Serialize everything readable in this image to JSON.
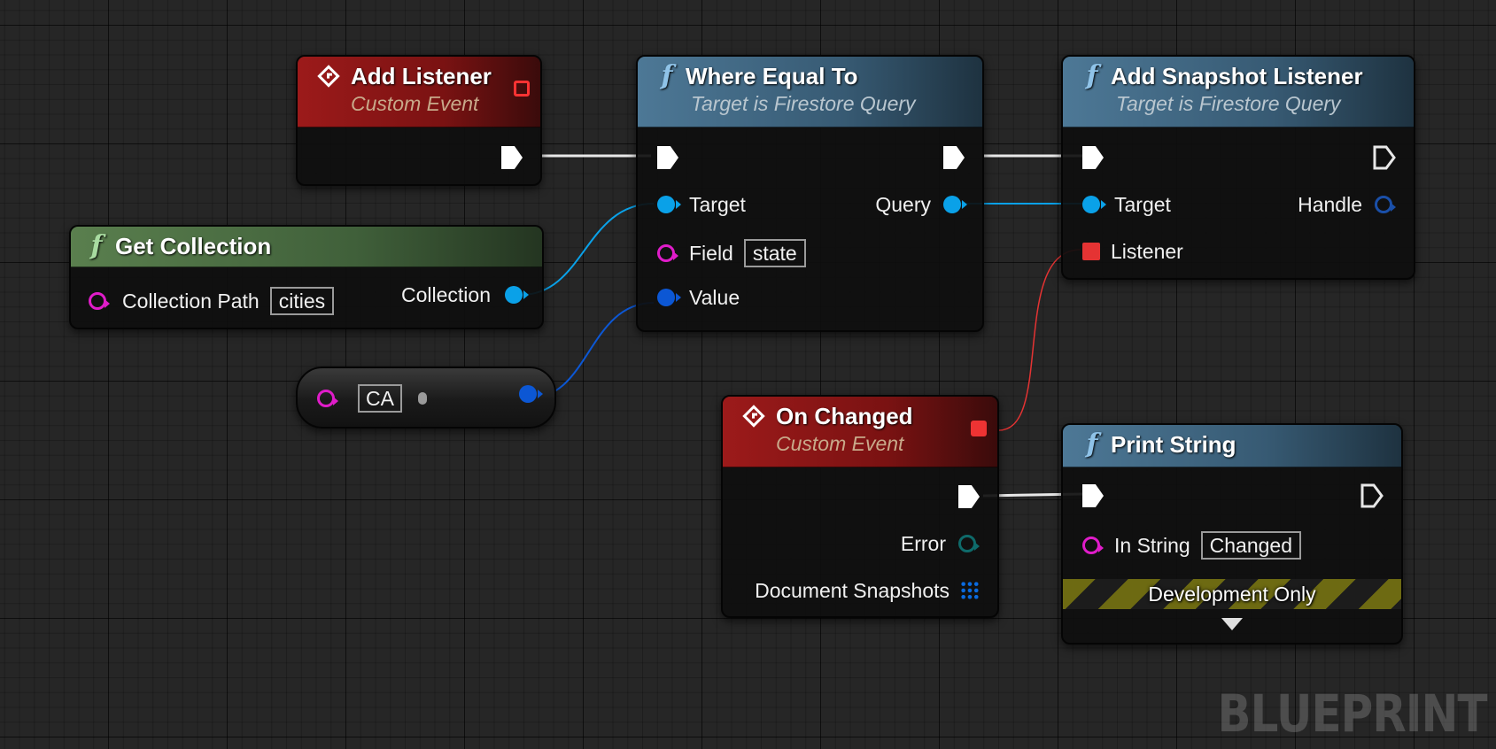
{
  "nodes": {
    "add_listener": {
      "title": "Add Listener",
      "subtitle": "Custom Event"
    },
    "get_collection": {
      "title": "Get Collection",
      "pin_collection_path": "Collection Path",
      "collection_path_value": "cities",
      "pin_collection": "Collection"
    },
    "literal": {
      "value": "CA"
    },
    "where_equal_to": {
      "title": "Where Equal To",
      "subtitle": "Target is Firestore Query",
      "pin_target": "Target",
      "pin_query": "Query",
      "pin_field": "Field",
      "field_value": "state",
      "pin_value": "Value"
    },
    "add_snapshot_listener": {
      "title": "Add Snapshot Listener",
      "subtitle": "Target is Firestore Query",
      "pin_target": "Target",
      "pin_handle": "Handle",
      "pin_listener": "Listener"
    },
    "on_changed": {
      "title": "On Changed",
      "subtitle": "Custom Event",
      "pin_error": "Error",
      "pin_document_snapshots": "Document Snapshots"
    },
    "print_string": {
      "title": "Print String",
      "pin_in_string": "In String",
      "in_string_value": "Changed",
      "development_only": "Development Only"
    }
  },
  "pin_colors": {
    "exec": "#ffffff",
    "object": "#0aa1e8",
    "string": "#e01cc9",
    "value": "#0c57d4",
    "delegate": "#e53333",
    "error": "#0e6a6a"
  },
  "header_colors": {
    "event": "#9c1a1a",
    "function": "#4d7896",
    "pure": "#5a7f4e"
  },
  "watermark": "BLUEPRINT"
}
